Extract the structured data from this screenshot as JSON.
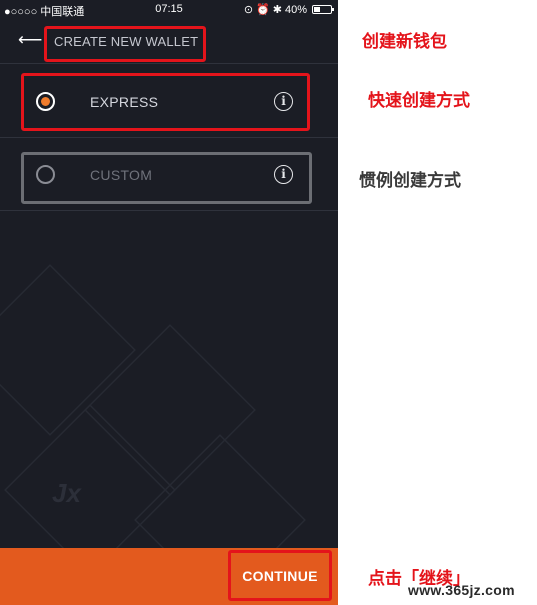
{
  "statusbar": {
    "carrier": "●○○○○ 中国联通",
    "time": "07:15",
    "battery_text": "40%",
    "battery_level": 0.4
  },
  "header": {
    "back_icon": "arrow-left-icon",
    "title": "CREATE NEW WALLET"
  },
  "options": [
    {
      "label": "EXPRESS",
      "selected": true,
      "info_icon": "info-icon",
      "info_glyph": "i"
    },
    {
      "label": "CUSTOM",
      "selected": false,
      "info_icon": "info-icon",
      "info_glyph": "i"
    }
  ],
  "watermark_logo": "Jx",
  "footer": {
    "continue_label": "CONTINUE"
  },
  "annotations": {
    "title_note": "创建新钱包",
    "express_note": "快速创建方式",
    "custom_note": "惯例创建方式",
    "continue_note": "点击「继续」"
  },
  "site_watermark": "www.365jz.com",
  "colors": {
    "background": "#1b1d25",
    "accent": "#e35a1e",
    "radio_dot": "#f07c2c",
    "annotation_red": "#e4141b"
  }
}
